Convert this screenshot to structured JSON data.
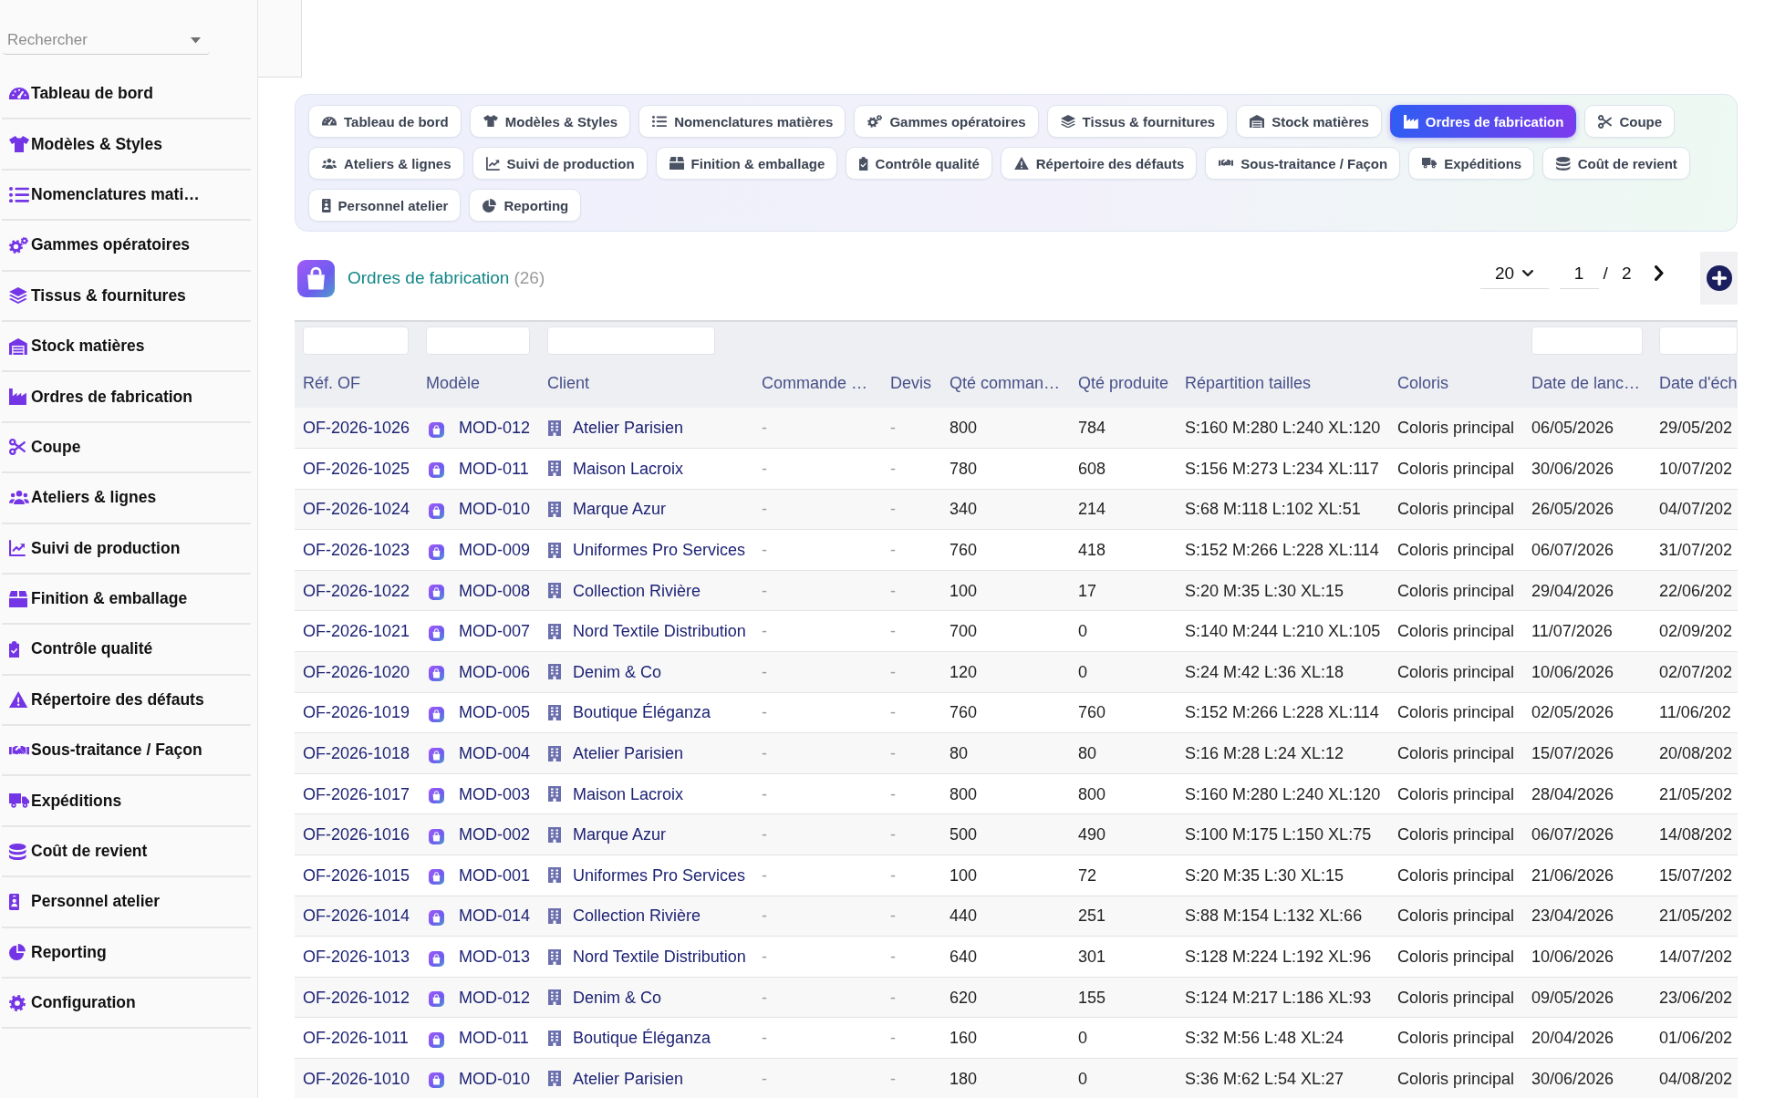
{
  "sidebar": {
    "search": {
      "placeholder": "Rechercher"
    },
    "items": [
      {
        "label": "Tableau de bord"
      },
      {
        "label": "Modèles & Styles"
      },
      {
        "label": "Nomenclatures mati…"
      },
      {
        "label": "Gammes opératoires"
      },
      {
        "label": "Tissus & fournitures"
      },
      {
        "label": "Stock matières"
      },
      {
        "label": "Ordres de fabrication"
      },
      {
        "label": "Coupe"
      },
      {
        "label": "Ateliers & lignes"
      },
      {
        "label": "Suivi de production"
      },
      {
        "label": "Finition & emballage"
      },
      {
        "label": "Contrôle qualité"
      },
      {
        "label": "Répertoire des défauts"
      },
      {
        "label": "Sous-traitance / Façon"
      },
      {
        "label": "Expéditions"
      },
      {
        "label": "Coût de revient"
      },
      {
        "label": "Personnel atelier"
      },
      {
        "label": "Reporting"
      },
      {
        "label": "Configuration"
      }
    ]
  },
  "tabs": [
    {
      "label": "Tableau de bord",
      "selected": false
    },
    {
      "label": "Modèles & Styles",
      "selected": false
    },
    {
      "label": "Nomenclatures matières",
      "selected": false
    },
    {
      "label": "Gammes opératoires",
      "selected": false
    },
    {
      "label": "Tissus & fournitures",
      "selected": false
    },
    {
      "label": "Stock matières",
      "selected": false
    },
    {
      "label": "Ordres de fabrication",
      "selected": true
    },
    {
      "label": "Coupe",
      "selected": false
    },
    {
      "label": "Ateliers & lignes",
      "selected": false
    },
    {
      "label": "Suivi de production",
      "selected": false
    },
    {
      "label": "Finition & emballage",
      "selected": false
    },
    {
      "label": "Contrôle qualité",
      "selected": false
    },
    {
      "label": "Répertoire des défauts",
      "selected": false
    },
    {
      "label": "Sous-traitance / Façon",
      "selected": false
    },
    {
      "label": "Expéditions",
      "selected": false
    },
    {
      "label": "Coût de revient",
      "selected": false
    },
    {
      "label": "Personnel atelier",
      "selected": false
    },
    {
      "label": "Reporting",
      "selected": false
    }
  ],
  "list_header": {
    "title": "Ordres de fabrication",
    "count": "(26)"
  },
  "pagination": {
    "page_size": "20",
    "page": "1",
    "separator": "/",
    "total_pages": "2"
  },
  "table": {
    "columns": [
      {
        "label": "Réf. OF",
        "kind": "ref",
        "filter": true
      },
      {
        "label": "Modèle",
        "kind": "model",
        "filter": true
      },
      {
        "label": "Client",
        "kind": "client",
        "filter": true
      },
      {
        "label": "Commande …",
        "kind": "muted",
        "filter": false
      },
      {
        "label": "Devis",
        "kind": "muted",
        "filter": false
      },
      {
        "label": "Qté comman…",
        "kind": "text",
        "filter": false
      },
      {
        "label": "Qté produite",
        "kind": "text",
        "filter": false
      },
      {
        "label": "Répartition tailles",
        "kind": "text",
        "filter": false
      },
      {
        "label": "Coloris",
        "kind": "text",
        "filter": false
      },
      {
        "label": "Date de lanc…",
        "kind": "text",
        "filter": true
      },
      {
        "label": "Date d'éch",
        "kind": "text",
        "filter": true
      }
    ],
    "rows": [
      {
        "cells": [
          "OF-2026-1026",
          "MOD-012",
          "Atelier Parisien",
          "-",
          "-",
          "800",
          "784",
          "S:160 M:280 L:240 XL:120",
          "Coloris principal",
          "06/05/2026",
          "29/05/202"
        ]
      },
      {
        "cells": [
          "OF-2026-1025",
          "MOD-011",
          "Maison Lacroix",
          "-",
          "-",
          "780",
          "608",
          "S:156 M:273 L:234 XL:117",
          "Coloris principal",
          "30/06/2026",
          "10/07/202"
        ]
      },
      {
        "cells": [
          "OF-2026-1024",
          "MOD-010",
          "Marque Azur",
          "-",
          "-",
          "340",
          "214",
          "S:68 M:118 L:102 XL:51",
          "Coloris principal",
          "26/05/2026",
          "04/07/202"
        ]
      },
      {
        "cells": [
          "OF-2026-1023",
          "MOD-009",
          "Uniformes Pro Services",
          "-",
          "-",
          "760",
          "418",
          "S:152 M:266 L:228 XL:114",
          "Coloris principal",
          "06/07/2026",
          "31/07/202"
        ]
      },
      {
        "cells": [
          "OF-2026-1022",
          "MOD-008",
          "Collection Rivière",
          "-",
          "-",
          "100",
          "17",
          "S:20 M:35 L:30 XL:15",
          "Coloris principal",
          "29/04/2026",
          "22/06/202"
        ]
      },
      {
        "cells": [
          "OF-2026-1021",
          "MOD-007",
          "Nord Textile Distribution",
          "-",
          "-",
          "700",
          "0",
          "S:140 M:244 L:210 XL:105",
          "Coloris principal",
          "11/07/2026",
          "02/09/202"
        ]
      },
      {
        "cells": [
          "OF-2026-1020",
          "MOD-006",
          "Denim & Co",
          "-",
          "-",
          "120",
          "0",
          "S:24 M:42 L:36 XL:18",
          "Coloris principal",
          "10/06/2026",
          "02/07/202"
        ]
      },
      {
        "cells": [
          "OF-2026-1019",
          "MOD-005",
          "Boutique Éléganza",
          "-",
          "-",
          "760",
          "760",
          "S:152 M:266 L:228 XL:114",
          "Coloris principal",
          "02/05/2026",
          "11/06/202"
        ]
      },
      {
        "cells": [
          "OF-2026-1018",
          "MOD-004",
          "Atelier Parisien",
          "-",
          "-",
          "80",
          "80",
          "S:16 M:28 L:24 XL:12",
          "Coloris principal",
          "15/07/2026",
          "20/08/202"
        ]
      },
      {
        "cells": [
          "OF-2026-1017",
          "MOD-003",
          "Maison Lacroix",
          "-",
          "-",
          "800",
          "800",
          "S:160 M:280 L:240 XL:120",
          "Coloris principal",
          "28/04/2026",
          "21/05/202"
        ]
      },
      {
        "cells": [
          "OF-2026-1016",
          "MOD-002",
          "Marque Azur",
          "-",
          "-",
          "500",
          "490",
          "S:100 M:175 L:150 XL:75",
          "Coloris principal",
          "06/07/2026",
          "14/08/202"
        ]
      },
      {
        "cells": [
          "OF-2026-1015",
          "MOD-001",
          "Uniformes Pro Services",
          "-",
          "-",
          "100",
          "72",
          "S:20 M:35 L:30 XL:15",
          "Coloris principal",
          "21/06/2026",
          "15/07/202"
        ]
      },
      {
        "cells": [
          "OF-2026-1014",
          "MOD-014",
          "Collection Rivière",
          "-",
          "-",
          "440",
          "251",
          "S:88 M:154 L:132 XL:66",
          "Coloris principal",
          "23/04/2026",
          "21/05/202"
        ]
      },
      {
        "cells": [
          "OF-2026-1013",
          "MOD-013",
          "Nord Textile Distribution",
          "-",
          "-",
          "640",
          "301",
          "S:128 M:224 L:192 XL:96",
          "Coloris principal",
          "10/06/2026",
          "14/07/202"
        ]
      },
      {
        "cells": [
          "OF-2026-1012",
          "MOD-012",
          "Denim & Co",
          "-",
          "-",
          "620",
          "155",
          "S:124 M:217 L:186 XL:93",
          "Coloris principal",
          "09/05/2026",
          "23/06/202"
        ]
      },
      {
        "cells": [
          "OF-2026-1011",
          "MOD-011",
          "Boutique Éléganza",
          "-",
          "-",
          "160",
          "0",
          "S:32 M:56 L:48 XL:24",
          "Coloris principal",
          "20/04/2026",
          "01/06/202"
        ]
      },
      {
        "cells": [
          "OF-2026-1010",
          "MOD-010",
          "Atelier Parisien",
          "-",
          "-",
          "180",
          "0",
          "S:36 M:62 L:54 XL:27",
          "Coloris principal",
          "30/06/2026",
          "04/08/202"
        ]
      }
    ]
  }
}
